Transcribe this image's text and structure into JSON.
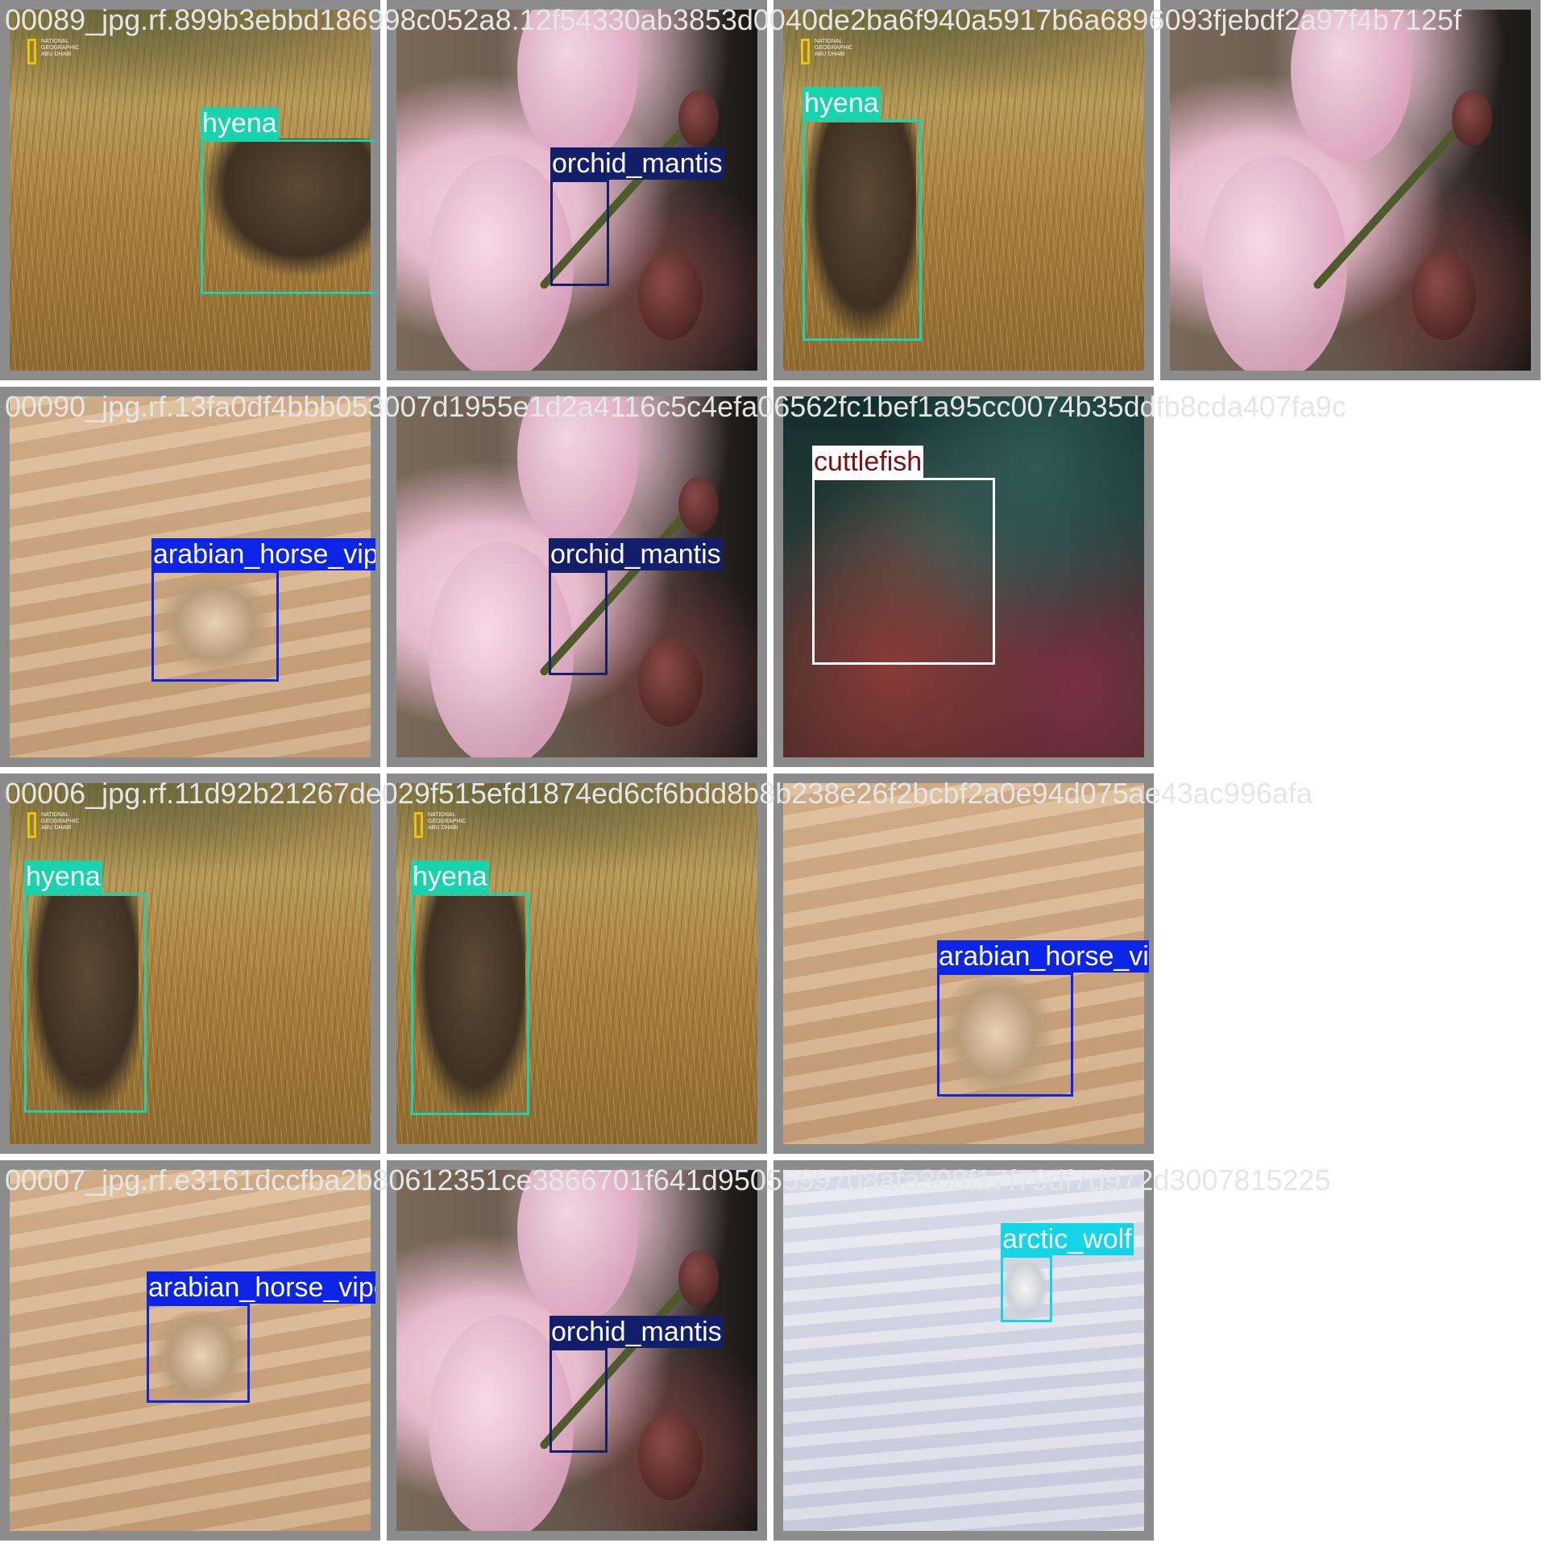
{
  "mosaic": {
    "rows": 4,
    "cols": 4,
    "border_color": "#8c8c8c",
    "background_color": "#ffffff"
  },
  "filenames": {
    "row1": "00089_jpg.rf.899b3ebbd186998c052a8.12f54330ab3853d0040de2ba6f940a5917b6a6896093fjebdf2a97f4b7125f",
    "row2": "00090_jpg.rf.13fa0df4bbb053007d1955e1d2a4116c5c4efa06562fc1bef1a95cc0074b35ddfb8cda407fa9c",
    "row3": "00006_jpg.rf.11d92b21267de029f515efd1874ed6cf6bdd8b8b238e26f2bcbf2a0e94d075ae43ac996afa",
    "row4": "00007_jpg.rf.e3161dccfba2b80612351ce3866701f641d9505599708afa308f17f79df7d972d3007815225"
  },
  "classes": {
    "hyena": {
      "label": "hyena",
      "color": "#17d3ae"
    },
    "orchid_mantis": {
      "label": "orchid_mantis",
      "color": "#131f6a"
    },
    "arabian_horse_viper": {
      "label": "arabian_horse_viper",
      "color": "#0b24e6"
    },
    "cuttlefish": {
      "label": "cuttlefish",
      "color": "#ffffff"
    },
    "arctic_wolf": {
      "label": "arctic_wolf",
      "color": "#14d4e8"
    }
  },
  "logo": {
    "lines": [
      "NATIONAL",
      "GEOGRAPHIC",
      "ABU DHABI"
    ]
  },
  "tiles": [
    {
      "scene": "savanna",
      "detections": [
        "hyena"
      ]
    },
    {
      "scene": "orchid",
      "detections": [
        "orchid_mantis"
      ]
    },
    {
      "scene": "savanna",
      "detections": [
        "hyena"
      ]
    },
    {
      "scene": "orchid",
      "detections": []
    },
    {
      "scene": "desert sand",
      "detections": [
        "arabian_horse_viper"
      ]
    },
    {
      "scene": "orchid",
      "detections": [
        "orchid_mantis"
      ]
    },
    {
      "scene": "coral reef",
      "detections": [
        "cuttlefish"
      ]
    },
    {
      "scene": "savanna",
      "detections": [
        "hyena"
      ]
    },
    {
      "scene": "savanna",
      "detections": [
        "hyena"
      ]
    },
    {
      "scene": "desert sand",
      "detections": [
        "arabian_horse_viper"
      ]
    },
    {
      "scene": "desert sand",
      "detections": [
        "arabian_horse_viper"
      ]
    },
    {
      "scene": "orchid",
      "detections": [
        "orchid_mantis"
      ]
    },
    {
      "scene": "snow",
      "detections": [
        "arctic_wolf"
      ]
    }
  ]
}
